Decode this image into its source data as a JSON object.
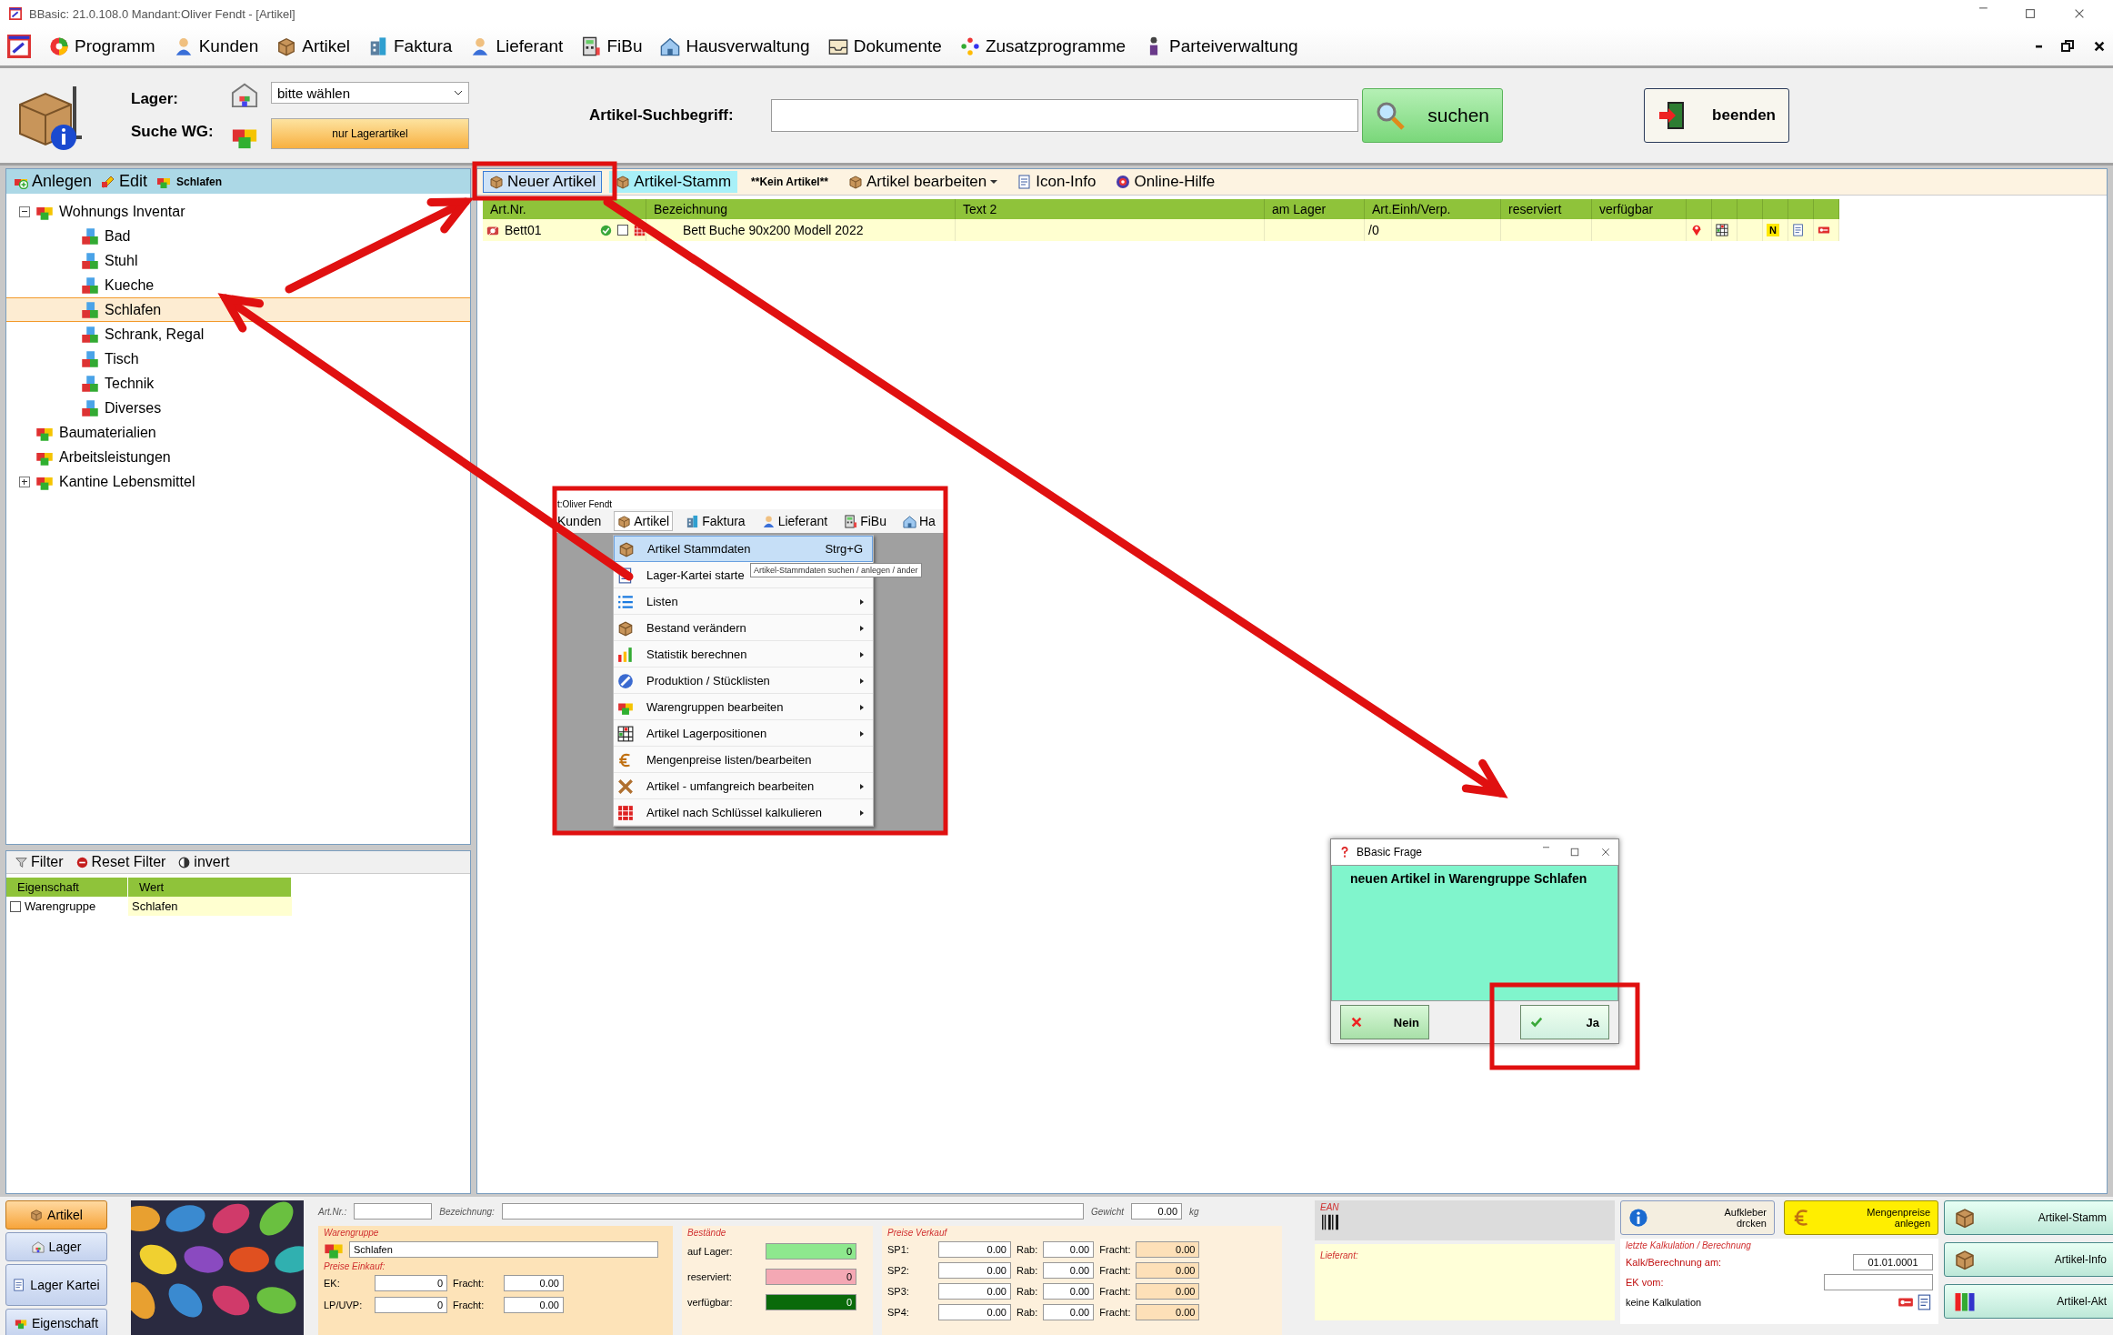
{
  "window": {
    "title": "BBasic: 21.0.108.0 Mandant:Oliver Fendt  - [Artikel]"
  },
  "menu": [
    {
      "label": "Programm"
    },
    {
      "label": "Kunden"
    },
    {
      "label": "Artikel"
    },
    {
      "label": "Faktura"
    },
    {
      "label": "Lieferant"
    },
    {
      "label": "FiBu"
    },
    {
      "label": "Hausverwaltung"
    },
    {
      "label": "Dokumente"
    },
    {
      "label": "Zusatzprogramme"
    },
    {
      "label": "Parteiverwaltung"
    }
  ],
  "search_bar": {
    "lager_label": "Lager:",
    "lager_value": "bitte wählen",
    "wg_label": "Suche WG:",
    "wg_button": "nur Lagerartikel",
    "search_label": "Artikel-Suchbegriff:",
    "search_button": "suchen",
    "exit_button": "beenden"
  },
  "tree_toolbar": {
    "buttons": [
      "Anlegen",
      "Edit"
    ],
    "current": "Schlafen"
  },
  "tree": [
    {
      "label": "Wohnungs Inventar",
      "expanded": true,
      "selected": false,
      "children": [
        {
          "label": "Bad",
          "selected": false
        },
        {
          "label": "Stuhl",
          "selected": false
        },
        {
          "label": "Kueche",
          "selected": false
        },
        {
          "label": "Schlafen",
          "selected": true
        },
        {
          "label": "Schrank, Regal",
          "selected": false
        },
        {
          "label": "Tisch",
          "selected": false
        },
        {
          "label": "Technik",
          "selected": false
        },
        {
          "label": "Diverses",
          "selected": false
        }
      ]
    },
    {
      "label": "Baumaterialien",
      "selected": false
    },
    {
      "label": "Arbeitsleistungen",
      "selected": false
    },
    {
      "label": "Kantine Lebensmittel",
      "expanded": false,
      "selected": false
    }
  ],
  "filter_toolbar": [
    "Filter",
    "Reset Filter",
    "invert"
  ],
  "properties": {
    "columns": [
      "Eigenschaft",
      "Wert"
    ],
    "rows": [
      {
        "checked": false,
        "name": "Warengruppe",
        "value": "Schlafen"
      }
    ]
  },
  "article_toolbar": [
    {
      "label": "Neuer Artikel",
      "kind": "pressed"
    },
    {
      "label": "Artikel-Stamm",
      "kind": "accent"
    },
    {
      "label": "**Kein Artikel**",
      "kind": "label"
    },
    {
      "label": "Artikel bearbeiten",
      "kind": "dropdown"
    },
    {
      "label": "Icon-Info",
      "kind": "button"
    },
    {
      "label": "Online-Hilfe",
      "kind": "button"
    }
  ],
  "table": {
    "columns": [
      "Art.Nr.",
      "Bezeichnung",
      "Text 2",
      "am Lager",
      "Art.Einh/Verp.",
      "reserviert",
      "verfügbar"
    ],
    "rows": [
      {
        "art_nr": "Bett01",
        "checked": false,
        "bezeichnung": "Bett Buche 90x200 Modell 2022",
        "einheit": "/0",
        "badge": "N"
      }
    ]
  },
  "menu_screenshot": {
    "title": "t:Oliver Fendt",
    "menu": [
      {
        "label": "Kunden",
        "selected": false
      },
      {
        "label": "Artikel",
        "selected": true
      },
      {
        "label": "Faktura",
        "selected": false
      },
      {
        "label": "Lieferant",
        "selected": false
      },
      {
        "label": "FiBu",
        "selected": false
      },
      {
        "label": "Ha",
        "selected": false
      }
    ],
    "items": [
      {
        "label": "Artikel Stammdaten",
        "shortcut": "Strg+G",
        "submenu": false,
        "selected": true
      },
      {
        "label": "Lager-Kartei starte",
        "submenu": false,
        "selected": false
      },
      {
        "label": "Listen",
        "submenu": true,
        "selected": false
      },
      {
        "label": "Bestand verändern",
        "submenu": true,
        "selected": false
      },
      {
        "label": "Statistik berechnen",
        "submenu": true,
        "selected": false
      },
      {
        "label": "Produktion / Stücklisten",
        "submenu": true,
        "selected": false
      },
      {
        "label": "Warengruppen bearbeiten",
        "submenu": true,
        "selected": false
      },
      {
        "label": "Artikel Lagerpositionen",
        "submenu": true,
        "selected": false
      },
      {
        "label": "Mengenpreise listen/bearbeiten",
        "submenu": false,
        "selected": false
      },
      {
        "label": "Artikel - umfangreich bearbeiten",
        "submenu": true,
        "selected": false
      },
      {
        "label": "Artikel nach Schlüssel kalkulieren",
        "submenu": true,
        "selected": false
      }
    ],
    "tooltip": "Artikel-Stammdaten suchen / anlegen / änder"
  },
  "dialog": {
    "title": "BBasic Frage",
    "message": "neuen Artikel in Warengruppe Schlafen",
    "buttons": [
      {
        "label": "Nein",
        "kind": "cancel"
      },
      {
        "label": "Ja",
        "kind": "ok"
      }
    ]
  },
  "bottom": {
    "side_tabs": [
      {
        "label": "Artikel",
        "selected": true
      },
      {
        "label": "Lager",
        "selected": false
      },
      {
        "label": "Lager Kartei",
        "selected": false
      },
      {
        "label": "Eigenschaft",
        "selected": false
      }
    ],
    "art_nr_label": "Art.Nr.:",
    "bezeichnung_label": "Bezeichnung:",
    "gewicht_label": "Gewicht",
    "gewicht": "0.00",
    "gewicht_unit": "kg",
    "warengruppe": {
      "title": "Warengruppe",
      "value": "Schlafen"
    },
    "einkauf": {
      "title": "Preise Einkauf:",
      "rows": [
        {
          "label": "EK:",
          "value": "0",
          "fracht_label": "Fracht:",
          "fracht": "0.00"
        },
        {
          "label": "LP/UVP:",
          "value": "0",
          "fracht_label": "Fracht:",
          "fracht": "0.00"
        }
      ]
    },
    "bestaende": {
      "title": "Bestände",
      "rows": [
        {
          "label": "auf Lager:",
          "value": "0",
          "color": "#8ee88e"
        },
        {
          "label": "reserviert:",
          "value": "0",
          "color": "#f4a8b4"
        },
        {
          "label": "verfügbar:",
          "value": "0",
          "color": "#0a6a0a"
        }
      ]
    },
    "verkauf": {
      "title": "Preise Verkauf",
      "rows": [
        {
          "label": "SP1:",
          "value": "0.00",
          "rab_label": "Rab:",
          "rab": "0.00",
          "fracht_label": "Fracht:",
          "fracht": "0.00"
        },
        {
          "label": "SP2:",
          "value": "0.00",
          "rab_label": "Rab:",
          "rab": "0.00",
          "fracht_label": "Fracht:",
          "fracht": "0.00"
        },
        {
          "label": "SP3:",
          "value": "0.00",
          "rab_label": "Rab:",
          "rab": "0.00",
          "fracht_label": "Fracht:",
          "fracht": "0.00"
        },
        {
          "label": "SP4:",
          "value": "0.00",
          "rab_label": "Rab:",
          "rab": "0.00",
          "fracht_label": "Fracht:",
          "fracht": "0.00"
        }
      ]
    },
    "ean": {
      "title": "EAN"
    },
    "lieferant": {
      "title": "Lieferant:"
    },
    "action_buttons": [
      {
        "label": "Aufkleber drcken",
        "kind": "plain"
      },
      {
        "label": "Mengenpreise anlegen",
        "kind": "highlight"
      }
    ],
    "kalkulation": {
      "title": "letzte Kalkulation / Berechnung",
      "am_label": "Kalk/Berechnung am:",
      "am": "01.01.0001",
      "ek_label": "EK vom:",
      "status": "keine Kalkulation"
    },
    "nav_buttons": [
      {
        "label": "Artikel-Stamm"
      },
      {
        "label": "Artikel-Info"
      },
      {
        "label": "Artikel-Akt"
      }
    ]
  }
}
